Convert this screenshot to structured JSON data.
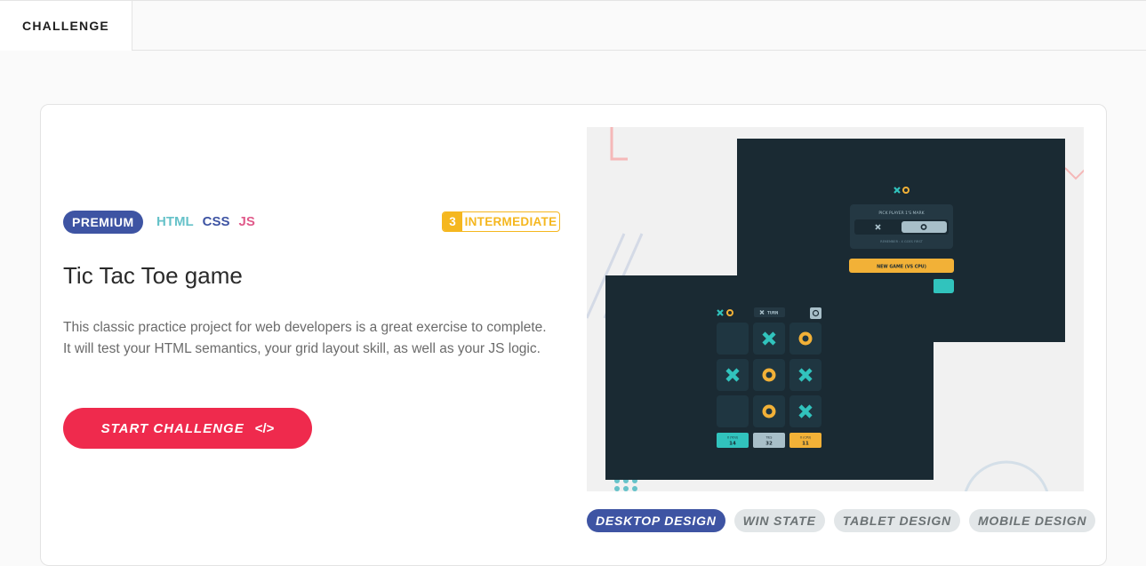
{
  "topbar": {
    "tab_label": "CHALLENGE"
  },
  "card": {
    "badge": "PREMIUM",
    "languages": [
      "HTML",
      "CSS",
      "JS"
    ],
    "level": {
      "number": "3",
      "label": "INTERMEDIATE"
    },
    "title": "Tic Tac Toe game",
    "description": "This classic practice project for web developers is a great exercise to complete. It will test your HTML semantics, your grid layout skill, as well as your JS logic.",
    "start_button": "START CHALLENGE",
    "code_icon": "</>"
  },
  "preview": {
    "menu": {
      "pick_text": "PICK PLAYER 1'S MARK",
      "remember_text": "REMEMBER : X GOES FIRST",
      "new_game_cpu": "NEW GAME (VS CPU)"
    },
    "game": {
      "turn_label": "TURN",
      "board": [
        "",
        "X",
        "O",
        "X",
        "O",
        "X",
        "",
        "O",
        "X"
      ],
      "scores": [
        {
          "label": "X (YOU)",
          "value": "14"
        },
        {
          "label": "TIES",
          "value": "32"
        },
        {
          "label": "O (CPU)",
          "value": "11"
        }
      ]
    }
  },
  "thumb_tabs": [
    "DESKTOP DESIGN",
    "WIN STATE",
    "TABLET DESIGN",
    "MOBILE DESIGN"
  ],
  "colors": {
    "brand_blue": "#3e54a3",
    "red": "#ef2a4d",
    "yellow": "#f5b71f",
    "teal": "#31c3bd",
    "dark_navy": "#1a2a33"
  }
}
